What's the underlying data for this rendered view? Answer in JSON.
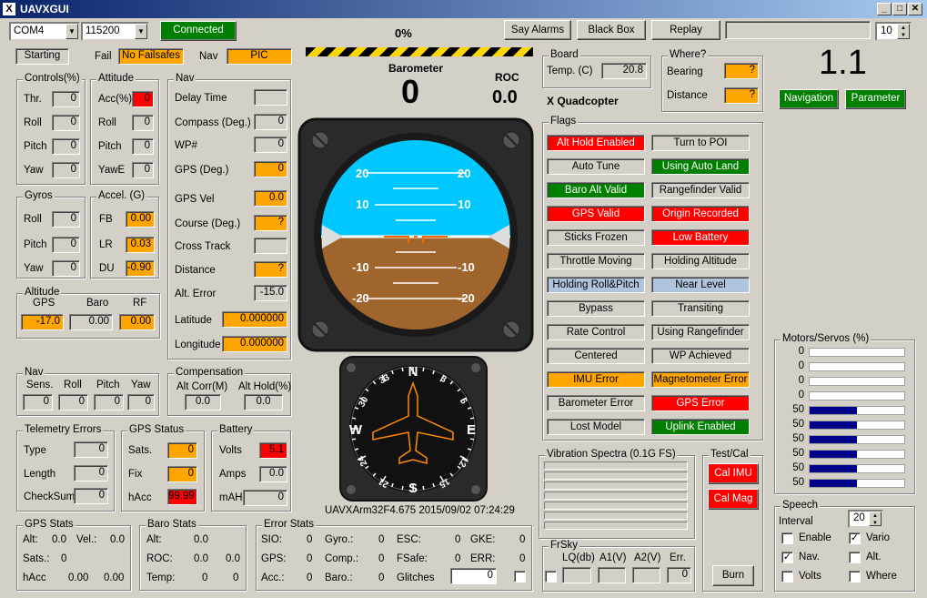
{
  "window": {
    "title": "UAVXGUI"
  },
  "toolbar": {
    "port": "COM4",
    "baud": "115200",
    "connect": "Connected",
    "progress": "0%",
    "say_alarms": "Say Alarms",
    "black_box": "Black Box",
    "replay": "Replay",
    "rate": "10"
  },
  "state": {
    "mode": "Starting",
    "fail_label": "Fail",
    "fail": "No Failsafes",
    "nav_label": "Nav",
    "nav": "PIC"
  },
  "controls": {
    "title": "Controls(%)",
    "rows": [
      {
        "l": "Thr.",
        "v": "0"
      },
      {
        "l": "Roll",
        "v": "0"
      },
      {
        "l": "Pitch",
        "v": "0"
      },
      {
        "l": "Yaw",
        "v": "0"
      }
    ]
  },
  "attitude": {
    "title": "Attitude",
    "rows": [
      {
        "l": "Acc(%)",
        "v": "0"
      },
      {
        "l": "Roll",
        "v": "0"
      },
      {
        "l": "Pitch",
        "v": "0"
      },
      {
        "l": "YawE",
        "v": "0"
      }
    ]
  },
  "gyros": {
    "title": "Gyros",
    "rows": [
      {
        "l": "Roll",
        "v": "0"
      },
      {
        "l": "Pitch",
        "v": "0"
      },
      {
        "l": "Yaw",
        "v": "0"
      }
    ]
  },
  "accel": {
    "title": "Accel. (G)",
    "rows": [
      {
        "l": "FB",
        "v": "0.00"
      },
      {
        "l": "LR",
        "v": "0.03"
      },
      {
        "l": "DU",
        "v": "-0.90"
      }
    ]
  },
  "altitude": {
    "title": "Altitude",
    "gps_l": "GPS",
    "baro_l": "Baro",
    "rf_l": "RF",
    "gps": "-17.0",
    "baro": "0.00",
    "rf": "0.00"
  },
  "nav": {
    "title": "Nav",
    "rows": [
      {
        "l": "Delay Time",
        "v": ""
      },
      {
        "l": "Compass (Deg.)",
        "v": "0"
      },
      {
        "l": "WP#",
        "v": "0"
      },
      {
        "l": "GPS (Deg.)",
        "v": "0"
      },
      {
        "l": "GPS Vel",
        "v": "0.0"
      },
      {
        "l": "Course (Deg.)",
        "v": "?"
      },
      {
        "l": "Cross Track",
        "v": ""
      },
      {
        "l": "Distance",
        "v": "?"
      },
      {
        "l": "Alt. Error",
        "v": "-15.0"
      },
      {
        "l": "Latitude",
        "v": "0.000000"
      },
      {
        "l": "Longitude",
        "v": "0.000000"
      }
    ]
  },
  "navsens": {
    "title": "Nav",
    "sens": "Sens.",
    "roll": "Roll",
    "pitch": "Pitch",
    "yaw": "Yaw",
    "v": [
      "0",
      "0",
      "0",
      "0"
    ]
  },
  "comp": {
    "title": "Compensation",
    "altcorr_l": "Alt Corr(M)",
    "althold_l": "Alt Hold(%)",
    "altcorr": "0.0",
    "althold": "0.0"
  },
  "telem": {
    "title": "Telemetry Errors",
    "type_l": "Type",
    "length_l": "Length",
    "checksum_l": "CheckSum",
    "type": "0",
    "length": "0",
    "checksum": "0"
  },
  "gpsstatus": {
    "title": "GPS Status",
    "sats_l": "Sats.",
    "fix_l": "Fix",
    "hacc_l": "hAcc",
    "sats": "0",
    "fix": "0",
    "hacc": "99.99"
  },
  "battery": {
    "title": "Battery",
    "volts_l": "Volts",
    "amps_l": "Amps",
    "mah_l": "mAH",
    "volts": "5.1",
    "amps": "0.0",
    "mah": "0"
  },
  "gpsstats": {
    "title": "GPS Stats",
    "alt_l": "Alt:",
    "alt": "0.0",
    "vel_l": "Vel.:",
    "vel": "0.0",
    "sats_l": "Sats.:",
    "sats": "0",
    "hacc_l": "hAcc",
    "hacc": "0.00",
    "hacc2": "0.00"
  },
  "barostats": {
    "title": "Baro Stats",
    "alt_l": "Alt:",
    "alt": "0.0",
    "roc_l": "ROC:",
    "roc": "0.0",
    "roc2": "0.0",
    "temp_l": "Temp:",
    "temp": "0",
    "temp2": "0"
  },
  "errstats": {
    "title": "Error Stats",
    "c1": [
      {
        "l": "SIO:",
        "v": "0"
      },
      {
        "l": "GPS:",
        "v": "0"
      },
      {
        "l": "Acc.:",
        "v": "0"
      }
    ],
    "c2": [
      {
        "l": "Gyro.:",
        "v": "0"
      },
      {
        "l": "Comp.:",
        "v": "0"
      },
      {
        "l": "Baro.:",
        "v": "0"
      }
    ],
    "c3": [
      {
        "l": "ESC:",
        "v": "0"
      },
      {
        "l": "FSafe:",
        "v": "0"
      },
      {
        "l": "Glitches",
        "v": "0"
      }
    ],
    "c4": [
      {
        "l": "GKE:",
        "v": "0"
      },
      {
        "l": "ERR:",
        "v": "0"
      }
    ]
  },
  "instruments": {
    "baro_label": "Barometer",
    "baro_value": "0",
    "roc_label": "ROC",
    "roc_value": "0.0",
    "pitch_ticks": [
      "20",
      "10",
      "-10",
      "-20"
    ],
    "compass": {
      "N": "N",
      "E": "E",
      "S": "S",
      "W": "W",
      "n30": "30",
      "n33": "33",
      "n3": "3",
      "n6": "6",
      "n12": "12",
      "n15": "15",
      "n21": "21",
      "n24": "24"
    },
    "footer": "UAVXArm32F4.675 2015/09/02 07:24:29"
  },
  "board": {
    "title": "Board",
    "temp_l": "Temp. (C)",
    "temp": "20.8",
    "airframe": "X Quadcopter"
  },
  "where": {
    "title": "Where?",
    "bearing_l": "Bearing",
    "distance_l": "Distance",
    "bearing": "?",
    "distance": "?"
  },
  "version": "1.1",
  "nav_btn": "Navigation",
  "param_btn": "Parameter",
  "flags": {
    "title": "Flags",
    "items": [
      {
        "t": "Alt Hold Enabled",
        "s": "red"
      },
      {
        "t": "Turn to POI",
        "s": "off"
      },
      {
        "t": "Auto Tune",
        "s": "off"
      },
      {
        "t": "Using Auto Land",
        "s": "green"
      },
      {
        "t": "Baro Alt Valid",
        "s": "green"
      },
      {
        "t": "Rangefinder Valid",
        "s": "off"
      },
      {
        "t": "GPS Valid",
        "s": "red"
      },
      {
        "t": "Origin Recorded",
        "s": "red"
      },
      {
        "t": "Sticks Frozen",
        "s": "off"
      },
      {
        "t": "Low Battery",
        "s": "red"
      },
      {
        "t": "Throttle Moving",
        "s": "off"
      },
      {
        "t": "Holding Altitude",
        "s": "off"
      },
      {
        "t": "Holding Roll&Pitch",
        "s": "blue"
      },
      {
        "t": "Near Level",
        "s": "blue"
      },
      {
        "t": "Bypass",
        "s": "off"
      },
      {
        "t": "Transiting",
        "s": "off"
      },
      {
        "t": "Rate Control",
        "s": "off"
      },
      {
        "t": "Using Rangefinder",
        "s": "off"
      },
      {
        "t": "Centered",
        "s": "off"
      },
      {
        "t": "WP Achieved",
        "s": "off"
      },
      {
        "t": "IMU Error",
        "s": "orange"
      },
      {
        "t": "Magnetometer Error",
        "s": "orange"
      },
      {
        "t": "Barometer Error",
        "s": "off"
      },
      {
        "t": "GPS Error",
        "s": "red"
      },
      {
        "t": "Lost Model",
        "s": "off"
      },
      {
        "t": "Uplink Enabled",
        "s": "green"
      }
    ]
  },
  "motors": {
    "title": "Motors/Servos (%)",
    "items": [
      {
        "v": "0",
        "p": 0
      },
      {
        "v": "0",
        "p": 0
      },
      {
        "v": "0",
        "p": 0
      },
      {
        "v": "0",
        "p": 0
      },
      {
        "v": "50",
        "p": 0.5
      },
      {
        "v": "50",
        "p": 0.5
      },
      {
        "v": "50",
        "p": 0.5
      },
      {
        "v": "50",
        "p": 0.5
      },
      {
        "v": "50",
        "p": 0.5
      },
      {
        "v": "50",
        "p": 0.5
      }
    ]
  },
  "speech": {
    "title": "Speech",
    "interval_l": "Interval",
    "interval": "20",
    "items": [
      {
        "l": "Enable",
        "c": false
      },
      {
        "l": "Vario",
        "c": true
      },
      {
        "l": "Nav.",
        "c": true
      },
      {
        "l": "Alt.",
        "c": false
      },
      {
        "l": "Volts",
        "c": false
      },
      {
        "l": "Where",
        "c": false
      }
    ]
  },
  "vibration": {
    "title": "Vibration Spectra (0.1G FS)"
  },
  "testcal": {
    "title": "Test/Cal",
    "cal_imu": "Cal IMU",
    "cal_mag": "Cal Mag",
    "burn": "Burn"
  },
  "frsky": {
    "title": "FrSky",
    "lq": "LQ(db)",
    "a1": "A1(V)",
    "a2": "A2(V)",
    "err": "Err.",
    "err_v": "0"
  }
}
